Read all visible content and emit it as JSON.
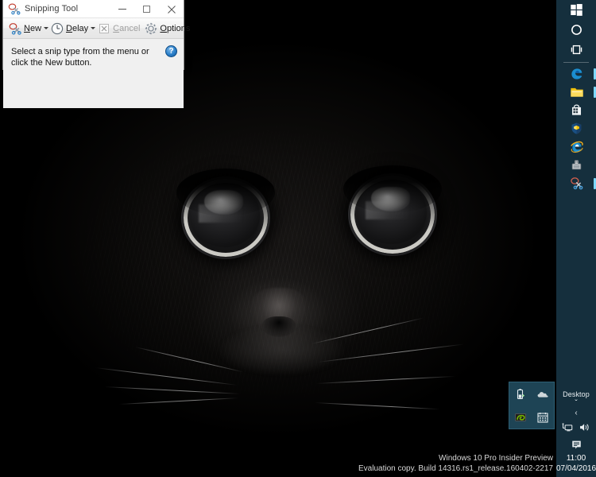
{
  "window": {
    "title": "Snipping Tool",
    "title_icon": "snipping-tool-scissors-icon",
    "caption": {
      "minimize_label": "–",
      "maximize_label": "□",
      "close_label": "✕"
    },
    "toolbar": {
      "new_label": "New",
      "new_icon": "scissors-icon",
      "new_caret": "▾",
      "delay_label": "Delay",
      "delay_icon": "clock-icon",
      "delay_caret": "▾",
      "cancel_label": "Cancel",
      "cancel_icon": "cancel-x-icon",
      "cancel_disabled": true,
      "options_label": "Options",
      "options_icon": "gear-icon"
    },
    "hint_text": "Select a snip type from the menu or click the New button.",
    "help_label": "?"
  },
  "taskbar": {
    "background_color": "#152f3d",
    "accent_color": "#7fd8ff",
    "system_buttons": [
      {
        "name": "start-button",
        "icon": "windows-logo-icon"
      },
      {
        "name": "cortana-button",
        "icon": "cortana-circle-icon"
      },
      {
        "name": "task-view-button",
        "icon": "task-view-icon"
      }
    ],
    "pinned_apps": [
      {
        "name": "microsoft-edge",
        "icon": "edge-icon",
        "running": true
      },
      {
        "name": "file-explorer",
        "icon": "folder-icon",
        "running": true
      },
      {
        "name": "store",
        "icon": "store-icon",
        "running": false
      },
      {
        "name": "windows-defender",
        "icon": "shield-icon",
        "running": false
      },
      {
        "name": "internet-explorer",
        "icon": "internet-explorer-icon",
        "running": false
      },
      {
        "name": "removable-drive",
        "icon": "usb-drive-icon",
        "running": false
      },
      {
        "name": "snipping-tool",
        "icon": "snipping-tool-scissors-icon",
        "running": true
      }
    ],
    "tray": {
      "desktop_label": "Desktop",
      "overflow_chevron": "ˇ",
      "show_hidden_chevron": "‹",
      "icons": [
        {
          "name": "network-icon",
          "icon": "network-monitor-icon"
        },
        {
          "name": "volume-icon",
          "icon": "speaker-icon"
        }
      ],
      "action_center_icon": "action-center-icon",
      "time": "11:00",
      "date": "07/04/2016"
    },
    "flyout": {
      "background_color": "#1e4455",
      "items": [
        {
          "name": "battery-icon",
          "icon": "battery-charging-icon"
        },
        {
          "name": "onedrive-icon",
          "icon": "cloud-icon"
        },
        {
          "name": "nvidia-settings-icon",
          "icon": "nvidia-green-icon"
        },
        {
          "name": "calendar-icon",
          "icon": "calendar-grid-icon"
        }
      ]
    }
  },
  "watermark": {
    "line1": "Windows 10 Pro Insider Preview",
    "line2": "Evaluation copy. Build 14316.rs1_release.160402-2217"
  },
  "wallpaper": {
    "description": "black-cat-face-closeup",
    "base_color": "#000000"
  }
}
